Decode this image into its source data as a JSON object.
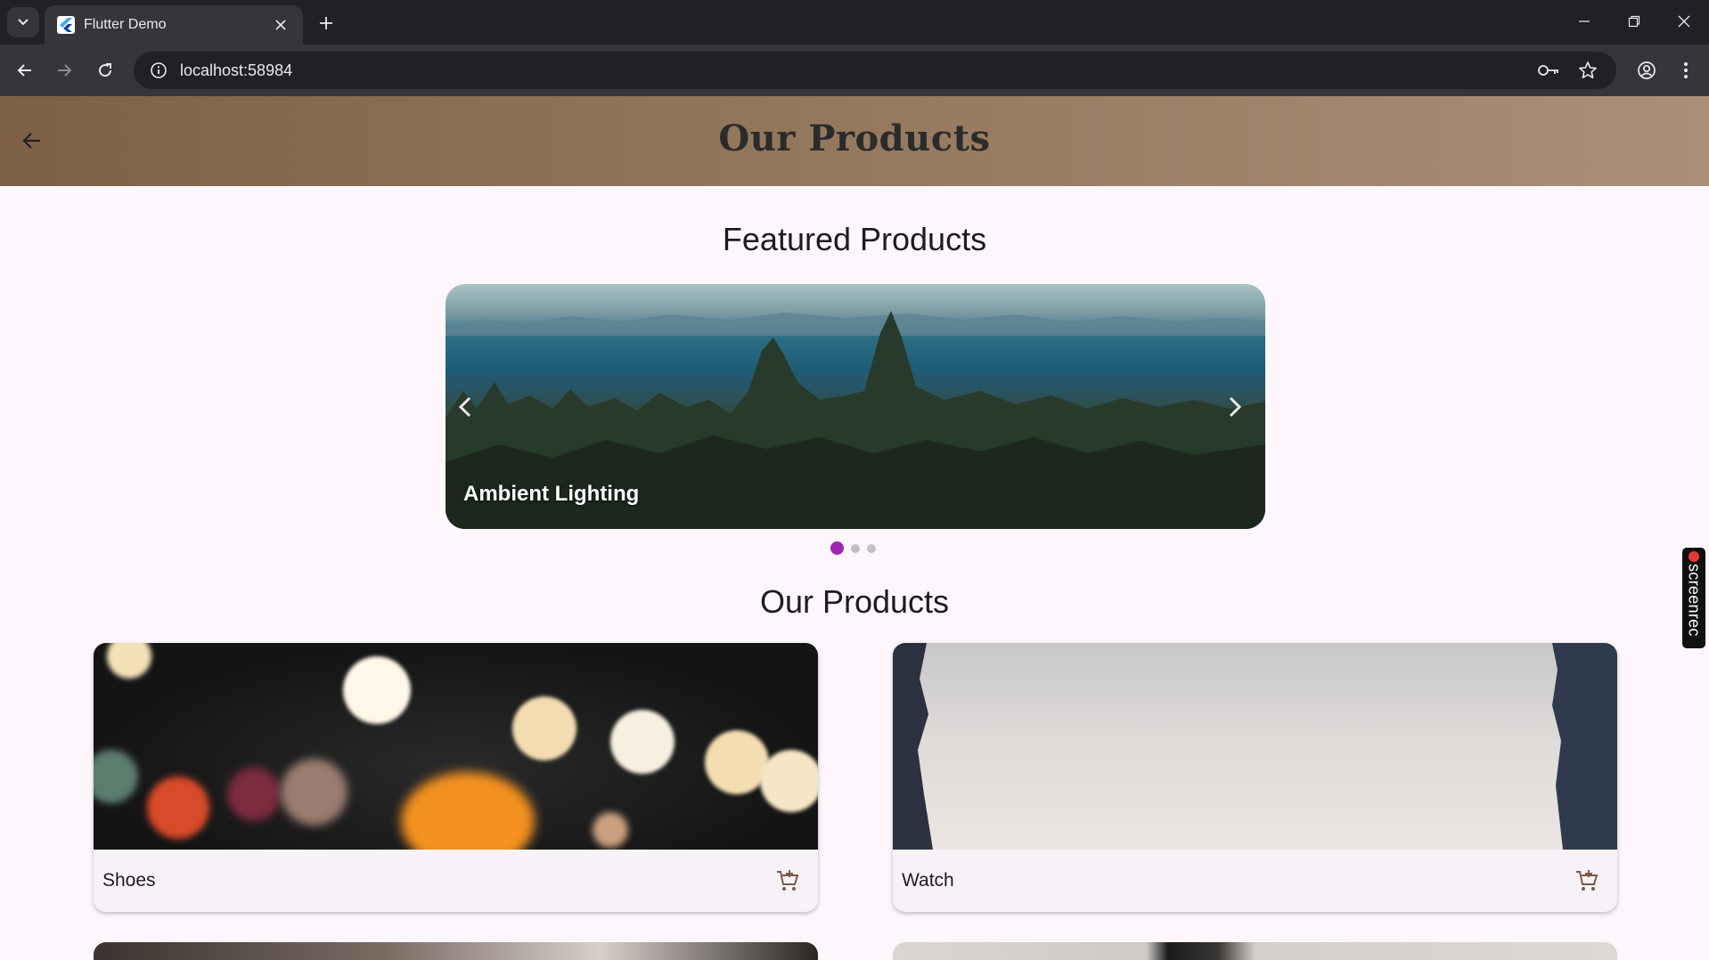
{
  "browser": {
    "tab_title": "Flutter Demo",
    "url": "localhost:58984"
  },
  "appbar": {
    "title": "Our Products"
  },
  "featured": {
    "heading": "Featured Products",
    "slides": [
      {
        "caption": "Ambient Lighting"
      }
    ],
    "active_index": 0,
    "dot_count": 3
  },
  "products": {
    "heading": "Our Products",
    "items": [
      {
        "name": "Shoes"
      },
      {
        "name": "Watch"
      }
    ]
  },
  "overlay": {
    "recorder_label": "screenrec"
  },
  "colors": {
    "accent": "#9c27b0",
    "appbar_start": "#7d6046",
    "appbar_end": "#aa9078",
    "background": "#fdf7fd"
  }
}
